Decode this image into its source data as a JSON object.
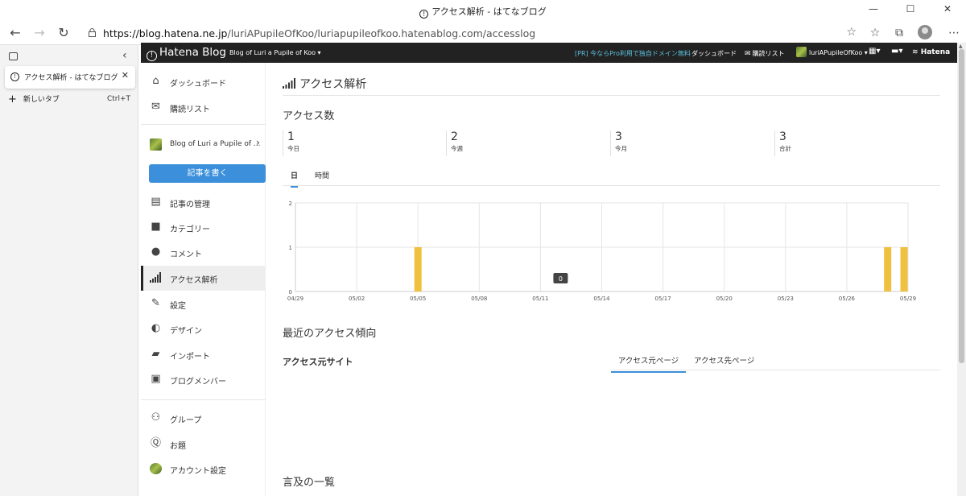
{
  "window": {
    "title": "アクセス解析 - はてなブログ",
    "minimize": "—",
    "maximize": "☐",
    "close": "✕"
  },
  "browser": {
    "url_domain": "https://blog.hatena.ne.jp",
    "url_path": "/luriAPupileOfKoo/luriapupileofkoo.hatenablog.com/accesslog"
  },
  "tabs_panel": {
    "active_tab_label": "アクセス解析 - はてなブログ",
    "new_tab_label": "新しいタブ",
    "new_tab_shortcut": "Ctrl+T"
  },
  "header": {
    "logo": "Hatena Blog",
    "blog_selector": "Blog of Luri a Pupile of Koo ▾",
    "promo": "[PR] 今ならPro利用で独自ドメイン無料",
    "dashboard": "ダッシュボード",
    "subscriptions": "購読リスト",
    "username": "luriAPupileOfKoo ▾",
    "hatena": "Hatena"
  },
  "sidebar": {
    "dashboard": "ダッシュボード",
    "subscriptions": "購読リスト",
    "blog_name": "Blog of Luri a Pupile of ...",
    "write_button": "記事を書く",
    "items": [
      "記事の管理",
      "カテゴリー",
      "コメント",
      "アクセス解析",
      "設定",
      "デザイン",
      "インポート",
      "ブログメンバー"
    ],
    "group": "グループ",
    "odai": "お題",
    "account": "アカウント設定"
  },
  "main": {
    "page_title": "アクセス解析",
    "access_count_title": "アクセス数",
    "stats": [
      {
        "num": "1",
        "label": "今日"
      },
      {
        "num": "2",
        "label": "今週"
      },
      {
        "num": "3",
        "label": "今月"
      },
      {
        "num": "3",
        "label": "合計"
      }
    ],
    "tab_day": "日",
    "tab_hour": "時間",
    "tooltip": "0",
    "trend_title": "最近のアクセス傾向",
    "referrer_site": "アクセス元サイト",
    "referrer_page_tab": "アクセス元ページ",
    "target_page_tab": "アクセス先ページ",
    "mentions_title": "言及の一覧"
  },
  "chart_data": {
    "type": "bar",
    "xlabels": [
      "04/29",
      "05/02",
      "05/05",
      "05/08",
      "05/11",
      "05/14",
      "05/17",
      "05/20",
      "05/23",
      "05/26",
      "05/29"
    ],
    "categories": [
      "04/29",
      "04/30",
      "05/01",
      "05/02",
      "05/03",
      "05/04",
      "05/05",
      "05/06",
      "05/07",
      "05/08",
      "05/09",
      "05/10",
      "05/11",
      "05/12",
      "05/13",
      "05/14",
      "05/15",
      "05/16",
      "05/17",
      "05/18",
      "05/19",
      "05/20",
      "05/21",
      "05/22",
      "05/23",
      "05/24",
      "05/25",
      "05/26",
      "05/27",
      "05/28",
      "05/29"
    ],
    "values": [
      0,
      0,
      0,
      0,
      0,
      0,
      1,
      0,
      0,
      0,
      0,
      0,
      0,
      0,
      0,
      0,
      0,
      0,
      0,
      0,
      0,
      0,
      0,
      0,
      0,
      0,
      0,
      0,
      0,
      1,
      1
    ],
    "yticks": [
      "0",
      "1",
      "2"
    ],
    "ylim": [
      0,
      2
    ],
    "bar_color": "#f0c040",
    "grid": true
  }
}
